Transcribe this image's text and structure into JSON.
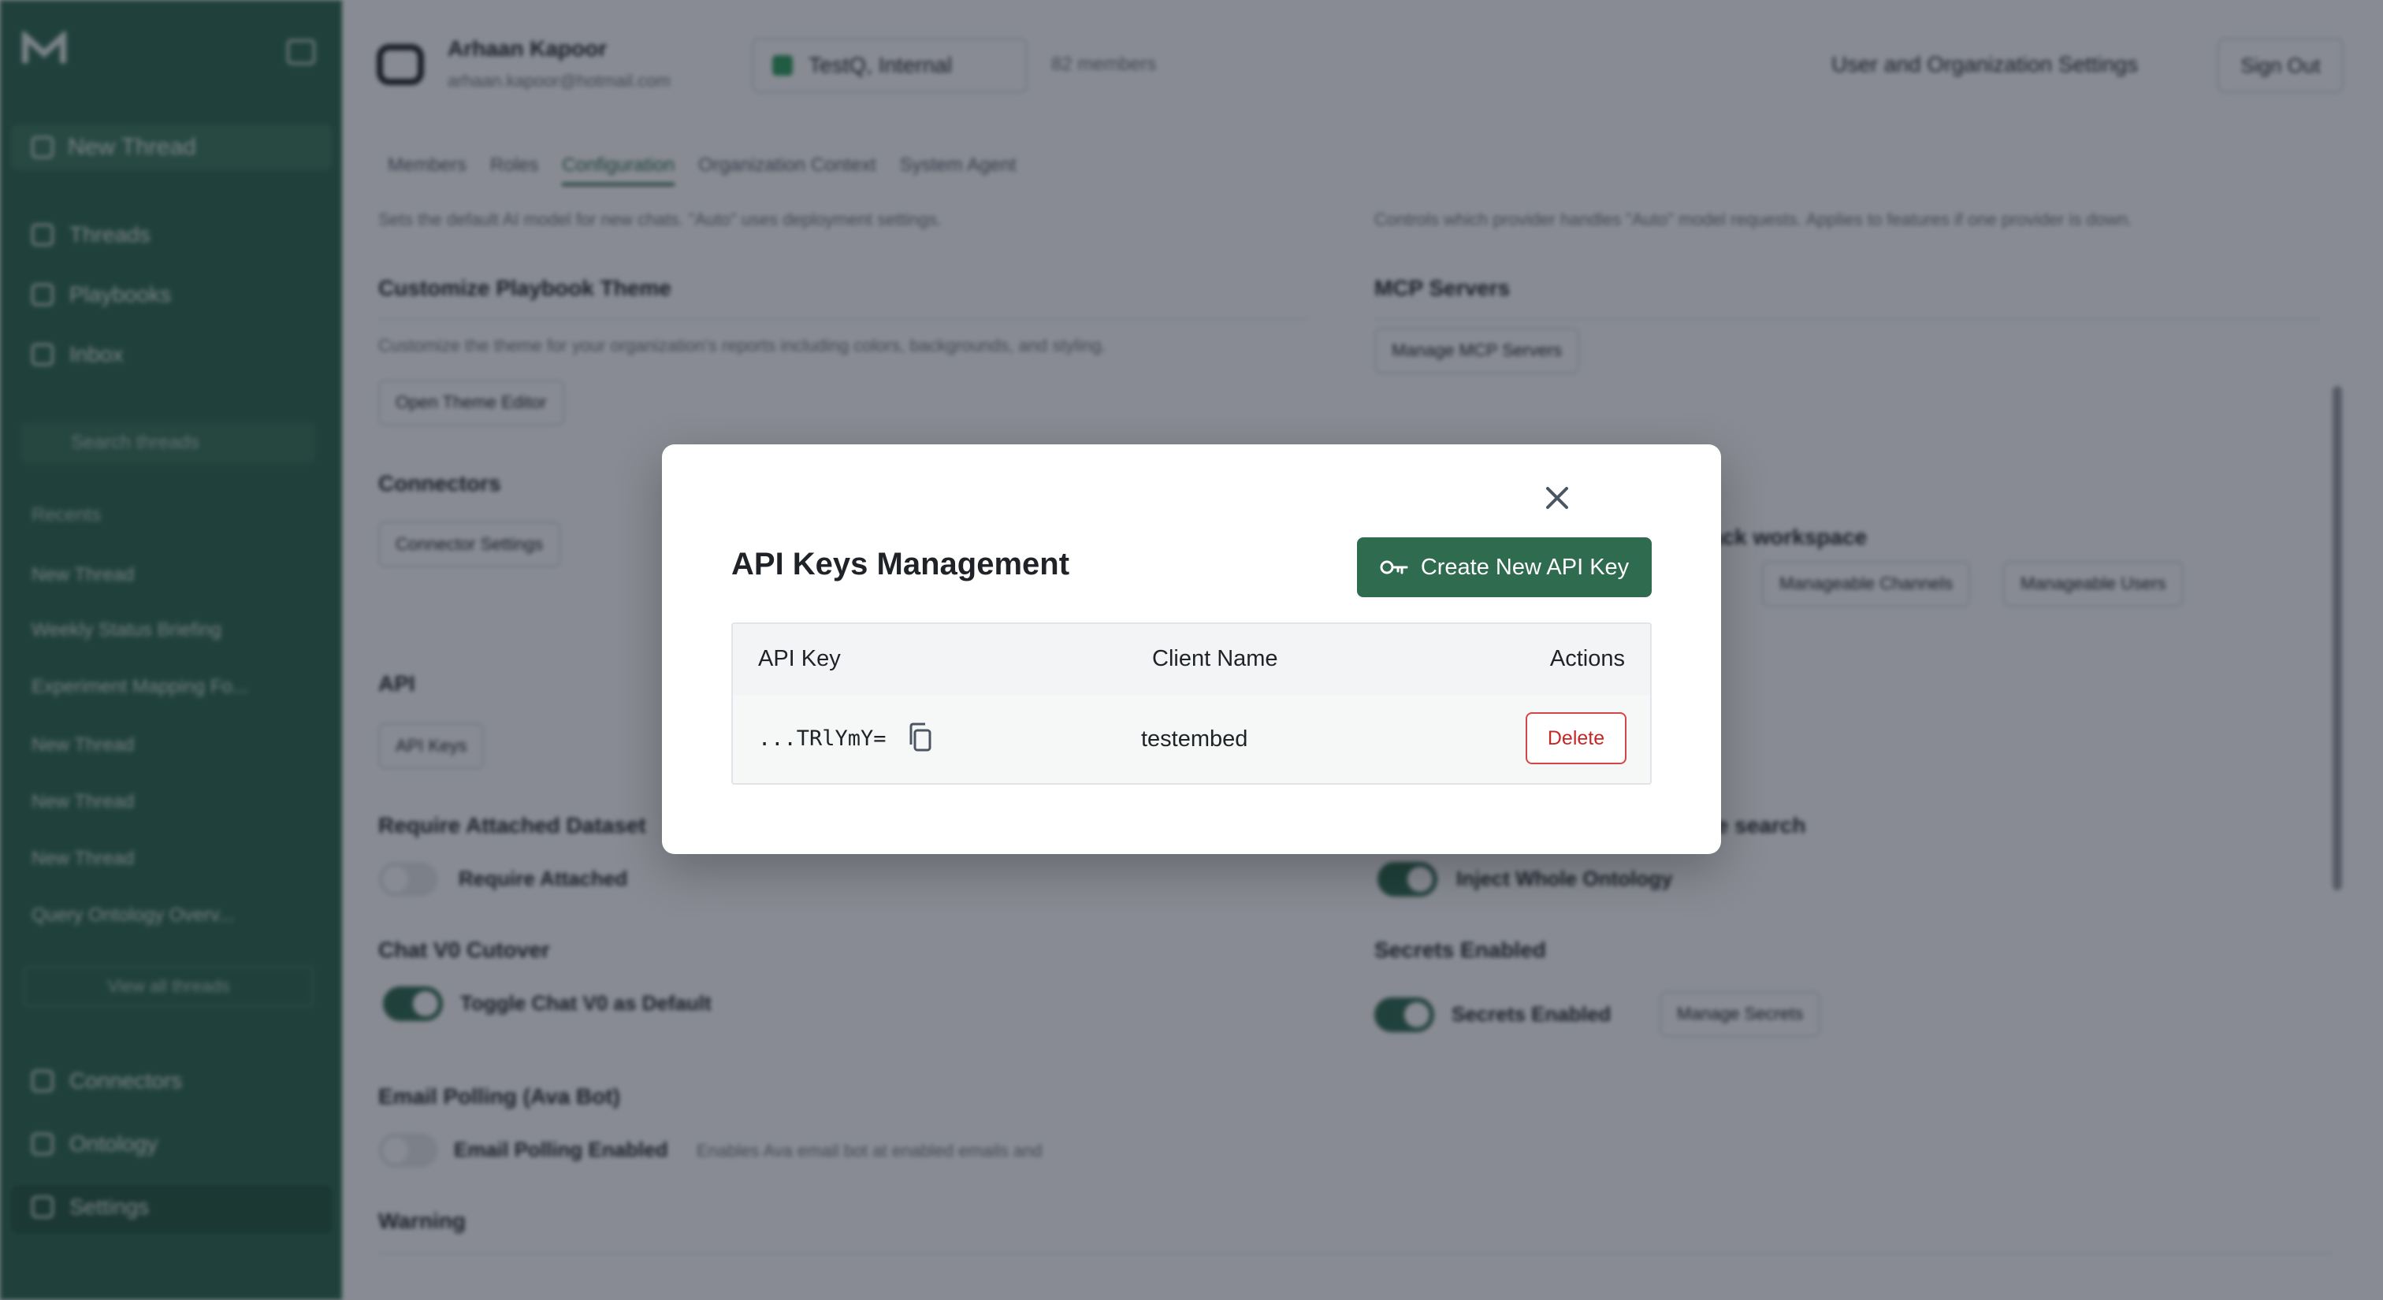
{
  "sidebar": {
    "new_thread": "New Thread",
    "nav": [
      "Threads",
      "Playbooks",
      "Inbox"
    ],
    "search_placeholder": "Search threads",
    "recents_title": "Recents",
    "recents": [
      "New Thread",
      "Weekly Status Briefing",
      "Experiment Mapping Fo...",
      "New Thread",
      "New Thread",
      "New Thread",
      "Query Ontology Overv..."
    ],
    "view_all": "View all threads",
    "bottom": [
      "Connectors",
      "Ontology",
      "Settings"
    ]
  },
  "header": {
    "user_name": "Arhaan Kapoor",
    "user_email": "arhaan.kapoor@hotmail.com",
    "org_name": "TestQ, Internal",
    "members": "82 members",
    "settings_link": "User and Organization Settings",
    "sign_out": "Sign Out"
  },
  "tabs": [
    "Members",
    "Roles",
    "Configuration",
    "Organization Context",
    "System Agent"
  ],
  "background": {
    "desc_left": "Sets the default AI model for new chats. \"Auto\" uses deployment settings.",
    "desc_right": "Controls which provider handles \"Auto\" model requests. Applies to features if one provider is down.",
    "theme_title": "Customize Playbook Theme",
    "theme_desc": "Customize the theme for your organization's reports including colors, backgrounds, and styling.",
    "theme_btn": "Open Theme Editor",
    "mcp_title": "MCP Servers",
    "mcp_btn": "Manage MCP Servers",
    "connectors_title": "Connectors",
    "connectors_btn": "Connector Settings",
    "workspace_partial": "ack workspace",
    "chip_channels": "Manageable Channels",
    "chip_users": "Manageable Users",
    "api_title": "API",
    "api_btn": "API Keys",
    "dataset_title": "Require Attached Dataset",
    "dataset_toggle": "Require Attached",
    "search_partial": "le search",
    "ontology_toggle": "Inject Whole Ontology",
    "chat_title": "Chat V0 Cutover",
    "chat_toggle": "Toggle Chat V0 as Default",
    "secrets_title": "Secrets Enabled",
    "secrets_toggle": "Secrets Enabled",
    "secrets_btn": "Manage Secrets",
    "email_title": "Email Polling (Ava Bot)",
    "email_toggle": "Email Polling Enabled",
    "email_desc": "Enables Ava email bot at enabled emails and",
    "warning_title": "Warning"
  },
  "modal": {
    "title": "API Keys Management",
    "create_button": "Create New API Key",
    "columns": {
      "api_key": "API Key",
      "client_name": "Client Name",
      "actions": "Actions"
    },
    "rows": [
      {
        "api_key": "...TRlYmY=",
        "client_name": "testembed",
        "action": "Delete"
      }
    ]
  },
  "colors": {
    "brand": "#2f6b4f",
    "danger": "#c62828",
    "overlay": "rgba(17,24,39,0.5)"
  }
}
